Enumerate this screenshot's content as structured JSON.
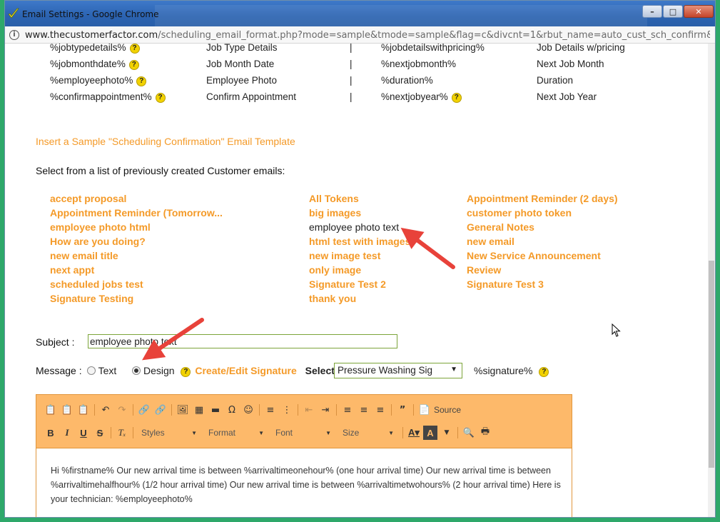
{
  "window": {
    "title": "Email Settings - Google Chrome",
    "url_host": "www.thecustomerfactor.com",
    "url_path": "/scheduling_email_format.php?mode=sample&tmode=sample&flag=c&divcnt=1&rbut_name=auto_cust_sch_confirm&slno=1...",
    "controls": {
      "minimize": "–",
      "maximize": "□",
      "close": "✕"
    }
  },
  "tokens": [
    {
      "left": "%jobtypedetails%",
      "left_help": true,
      "left_desc": "Job Type Details",
      "sep": "|",
      "right": "%jobdetailswithpricing%",
      "right_help": false,
      "right_desc": "Job Details w/pricing"
    },
    {
      "left": "%jobmonthdate%",
      "left_help": true,
      "left_desc": "Job Month Date",
      "sep": "|",
      "right": "%nextjobmonth%",
      "right_help": false,
      "right_desc": "Next Job Month"
    },
    {
      "left": "%employeephoto%",
      "left_help": true,
      "left_desc": "Employee Photo",
      "sep": "|",
      "right": "%duration%",
      "right_help": false,
      "right_desc": "Duration"
    },
    {
      "left": "%confirmappointment%",
      "left_help": true,
      "left_desc": "Confirm Appointment",
      "sep": "|",
      "right": "%nextjobyear%",
      "right_help": true,
      "right_desc": "Next Job Year"
    }
  ],
  "help_glyph": "?",
  "insert_sample_link": "Insert a Sample \"Scheduling Confirmation\" Email Template",
  "select_heading": "Select from a list of previously created Customer emails:",
  "email_templates": {
    "col1": [
      "accept proposal",
      "Appointment Reminder (Tomorrow...",
      "employee photo html",
      "How are you doing?",
      "new email title",
      "next appt",
      "scheduled jobs test",
      "Signature Testing"
    ],
    "col2": [
      "All Tokens",
      "big images",
      "employee photo text",
      "html test with images",
      "new image test",
      "only image",
      "Signature Test 2",
      "thank you"
    ],
    "col3": [
      "Appointment Reminder (2 days)",
      "customer photo token",
      "General Notes",
      "new email",
      "New Service Announcement",
      "Review",
      "Signature Test 3"
    ],
    "selected": "employee photo text"
  },
  "subject": {
    "label": "Subject :",
    "value": "employee photo text"
  },
  "message": {
    "label": "Message :",
    "text_option": "Text",
    "design_option": "Design",
    "selected": "Design",
    "edit_signature_link": "Create/Edit Signature",
    "select_sig_label": "Select Sig:",
    "select_sig_value": "Pressure Washing Sig",
    "signature_token": "%signature%"
  },
  "toolbar": {
    "styles": "Styles",
    "format": "Format",
    "font": "Font",
    "size": "Size",
    "source": "Source"
  },
  "editor_body": "Hi %firstname% Our new arrival time is between %arrivaltimeonehour% (one hour arrival time) Our new arrival time is between %arrivaltimehalfhour% (1/2 hour arrival time) Our new arrival time is between %arrivaltimetwohours% (2 hour arrival time) Here is your technician: %employeephoto%",
  "colors": {
    "accent_orange": "#f49a28",
    "toolbar_bg": "#fdb96a",
    "input_border": "#7ca43a",
    "annotation_arrow": "#e8423a",
    "desktop_green": "#2ea86a"
  }
}
